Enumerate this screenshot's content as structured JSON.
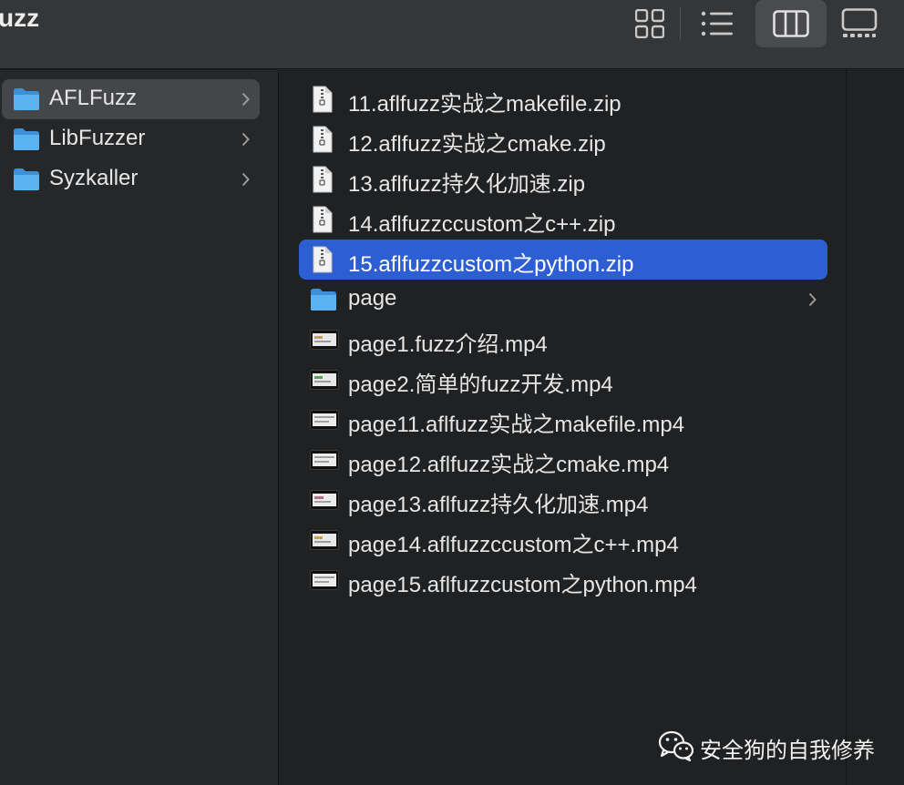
{
  "window": {
    "title": "uzz"
  },
  "toolbar": {
    "view_buttons": [
      {
        "name": "icon-view",
        "icon": "grid-icon",
        "active": false
      },
      {
        "name": "list-view",
        "icon": "list-icon",
        "active": false
      },
      {
        "name": "column-view",
        "icon": "columns-icon",
        "active": true
      },
      {
        "name": "gallery-view",
        "icon": "gallery-icon",
        "active": false
      }
    ]
  },
  "sidebar_column": {
    "items": [
      {
        "label": "AFLFuzz",
        "icon": "folder-icon",
        "selected": true
      },
      {
        "label": "LibFuzzer",
        "icon": "folder-icon",
        "selected": false
      },
      {
        "label": "Syzkaller",
        "icon": "folder-icon",
        "selected": false
      }
    ]
  },
  "files_column": {
    "items": [
      {
        "label": "11.aflfuzz实战之makefile.zip",
        "icon": "zip-file-icon"
      },
      {
        "label": "12.aflfuzz实战之cmake.zip",
        "icon": "zip-file-icon"
      },
      {
        "label": "13.aflfuzz持久化加速.zip",
        "icon": "zip-file-icon"
      },
      {
        "label": "14.aflfuzzccustom之c++.zip",
        "icon": "zip-file-icon"
      },
      {
        "label": "15.aflfuzzcustom之python.zip",
        "icon": "zip-file-icon",
        "selected": true
      },
      {
        "label": "page",
        "icon": "folder-icon",
        "has_children": true
      },
      {
        "label": "page1.fuzz介绍.mp4",
        "icon": "video-file-icon"
      },
      {
        "label": "page2.简单的fuzz开发.mp4",
        "icon": "video-file-icon"
      },
      {
        "label": "page11.aflfuzz实战之makefile.mp4",
        "icon": "video-file-icon"
      },
      {
        "label": "page12.aflfuzz实战之cmake.mp4",
        "icon": "video-file-icon"
      },
      {
        "label": "page13.aflfuzz持久化加速.mp4",
        "icon": "video-file-icon"
      },
      {
        "label": "page14.aflfuzzccustom之c++.mp4",
        "icon": "video-file-icon"
      },
      {
        "label": "page15.aflfuzzcustom之python.mp4",
        "icon": "video-file-icon"
      }
    ]
  },
  "watermark": {
    "text": "安全狗的自我修养",
    "icon": "wechat-icon"
  },
  "colors": {
    "selection_blue": "#2d5fd3",
    "folder_blue": "#5ab2f0",
    "sidebar_selection": "#454649"
  }
}
